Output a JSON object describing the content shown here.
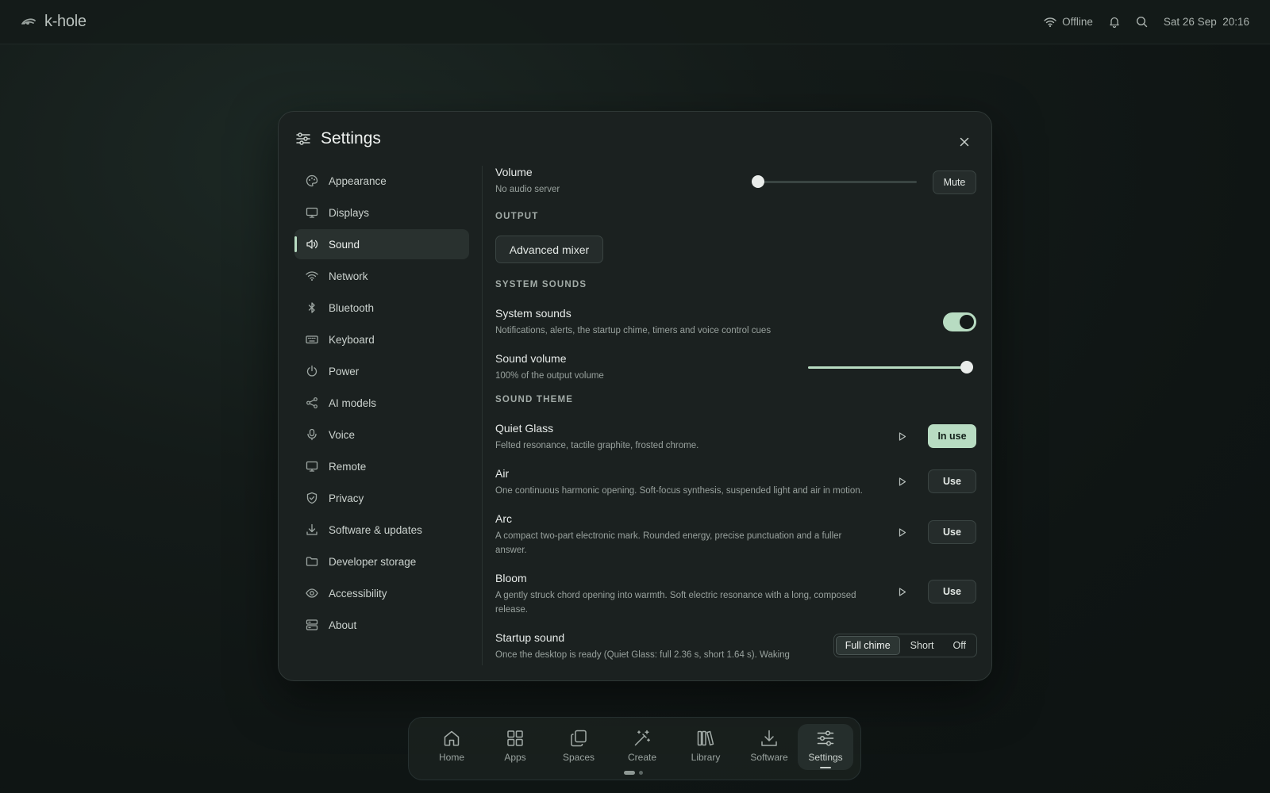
{
  "topbar": {
    "brand": "k-hole",
    "network_status": "Offline",
    "datetime": "Sat 26 Sep  20:16",
    "icons": [
      "k-hole-logo-icon",
      "wifi-icon",
      "bell-icon",
      "search-icon"
    ]
  },
  "settings": {
    "title": "Settings",
    "sidebar": {
      "items": [
        {
          "label": "Appearance",
          "icon": "palette-icon"
        },
        {
          "label": "Displays",
          "icon": "monitor-icon"
        },
        {
          "label": "Sound",
          "icon": "speaker-icon",
          "active": true
        },
        {
          "label": "Network",
          "icon": "wifi-icon"
        },
        {
          "label": "Bluetooth",
          "icon": "bluetooth-icon"
        },
        {
          "label": "Keyboard",
          "icon": "keyboard-icon"
        },
        {
          "label": "Power",
          "icon": "power-icon"
        },
        {
          "label": "AI models",
          "icon": "share-nodes-icon"
        },
        {
          "label": "Voice",
          "icon": "microphone-icon"
        },
        {
          "label": "Remote",
          "icon": "monitor-icon"
        },
        {
          "label": "Privacy",
          "icon": "shield-icon"
        },
        {
          "label": "Software & updates",
          "icon": "download-icon"
        },
        {
          "label": "Developer storage",
          "icon": "folder-icon"
        },
        {
          "label": "Accessibility",
          "icon": "eye-icon"
        },
        {
          "label": "About",
          "icon": "server-icon"
        }
      ]
    },
    "sound": {
      "volume": {
        "title": "Volume",
        "desc": "No audio server",
        "value": 0,
        "mute_label": "Mute"
      },
      "output": {
        "heading": "OUTPUT",
        "mixer_label": "Advanced mixer"
      },
      "system_sounds_heading": "SYSTEM SOUNDS",
      "system_sounds": {
        "title": "System sounds",
        "desc": "Notifications, alerts, the startup chime, timers and voice control cues",
        "enabled": true
      },
      "sound_volume": {
        "title": "Sound volume",
        "desc": "100% of the output volume",
        "value": 1.0
      },
      "theme_heading": "SOUND THEME",
      "themes": [
        {
          "title": "Quiet Glass",
          "desc": "Felted resonance, tactile graphite, frosted chrome.",
          "action": "In use",
          "in_use": true
        },
        {
          "title": "Air",
          "desc": "One continuous harmonic opening. Soft-focus synthesis, suspended light and air in motion.",
          "action": "Use",
          "in_use": false
        },
        {
          "title": "Arc",
          "desc": "A compact two-part electronic mark. Rounded energy, precise punctuation and a fuller answer.",
          "action": "Use",
          "in_use": false
        },
        {
          "title": "Bloom",
          "desc": "A gently struck chord opening into warmth. Soft electric resonance with a long, composed release.",
          "action": "Use",
          "in_use": false
        }
      ],
      "startup": {
        "title": "Startup sound",
        "desc": "Once the desktop is ready (Quiet Glass: full 2.36 s, short 1.64 s). Waking",
        "options": [
          "Full chime",
          "Short",
          "Off"
        ],
        "selected": "Full chime"
      }
    }
  },
  "dock": {
    "items": [
      {
        "label": "Home",
        "icon": "home-icon"
      },
      {
        "label": "Apps",
        "icon": "grid-icon"
      },
      {
        "label": "Spaces",
        "icon": "copy-icon"
      },
      {
        "label": "Create",
        "icon": "wand-icon"
      },
      {
        "label": "Library",
        "icon": "library-icon"
      },
      {
        "label": "Software",
        "icon": "download-icon"
      },
      {
        "label": "Settings",
        "icon": "sliders-icon",
        "active": true
      }
    ],
    "pages": 2,
    "current_page": 1
  }
}
